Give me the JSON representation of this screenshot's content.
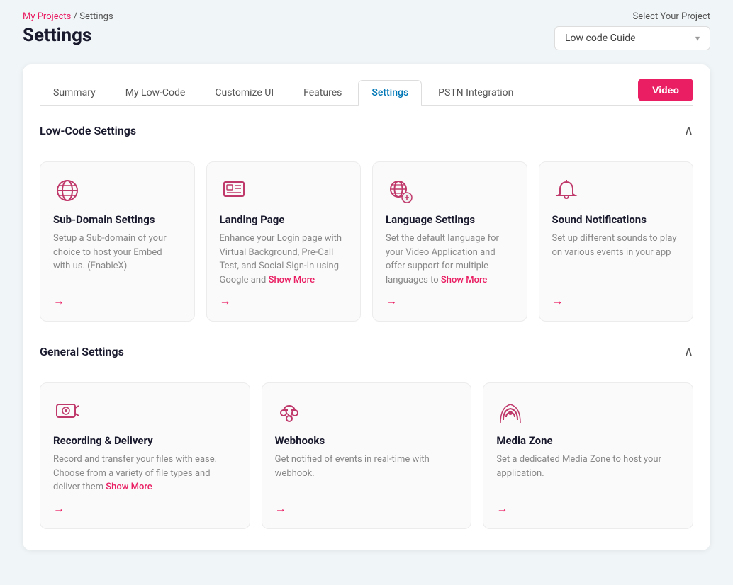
{
  "breadcrumb": {
    "my_projects": "My Projects",
    "separator": " / ",
    "current": "Settings"
  },
  "page_title": "Settings",
  "project_selector": {
    "label": "Select Your Project",
    "selected": "Low code Guide"
  },
  "video_button": "Video",
  "tabs": [
    {
      "id": "summary",
      "label": "Summary",
      "active": false
    },
    {
      "id": "my-low-code",
      "label": "My Low-Code",
      "active": false
    },
    {
      "id": "customize-ui",
      "label": "Customize UI",
      "active": false
    },
    {
      "id": "features",
      "label": "Features",
      "active": false
    },
    {
      "id": "settings",
      "label": "Settings",
      "active": true
    },
    {
      "id": "pstn-integration",
      "label": "PSTN Integration",
      "active": false
    }
  ],
  "low_code_settings": {
    "title": "Low-Code Settings",
    "cards": [
      {
        "id": "sub-domain",
        "title": "Sub-Domain Settings",
        "description": "Setup a Sub-domain of your choice to host your Embed with us. (EnableX)",
        "show_more": false,
        "icon": "globe"
      },
      {
        "id": "landing-page",
        "title": "Landing Page",
        "description": "Enhance your Login page with Virtual Background, Pre-Call Test, and Social Sign-In using Google and",
        "show_more": true,
        "icon": "landing"
      },
      {
        "id": "language-settings",
        "title": "Language Settings",
        "description": "Set the default language for your Video Application and offer support for multiple languages to",
        "show_more": true,
        "icon": "globe-settings"
      },
      {
        "id": "sound-notifications",
        "title": "Sound Notifications",
        "description": "Set up different sounds to play on various events in your app",
        "show_more": false,
        "icon": "bell"
      }
    ]
  },
  "general_settings": {
    "title": "General Settings",
    "cards": [
      {
        "id": "recording-delivery",
        "title": "Recording & Delivery",
        "description": "Record and transfer your files with ease. Choose from a variety of file types and deliver them",
        "show_more": true,
        "icon": "recording"
      },
      {
        "id": "webhooks",
        "title": "Webhooks",
        "description": "Get notified of events in real-time with webhook.",
        "show_more": false,
        "icon": "webhook"
      },
      {
        "id": "media-zone",
        "title": "Media Zone",
        "description": "Set a dedicated Media Zone to host your application.",
        "show_more": false,
        "icon": "signal"
      }
    ]
  },
  "show_more_label": "Show More",
  "arrow_symbol": "→"
}
